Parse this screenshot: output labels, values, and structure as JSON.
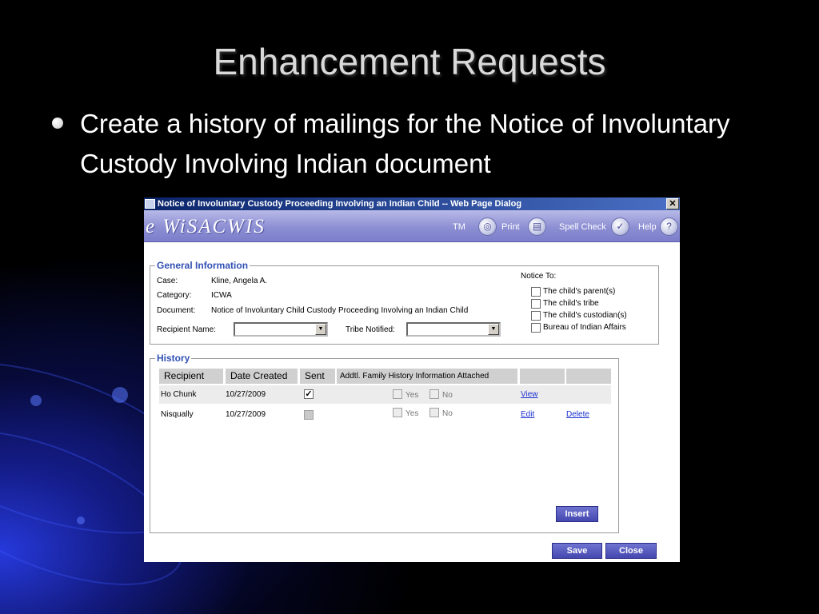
{
  "slide": {
    "title": "Enhancement Requests",
    "bullet": "Create a history of mailings for the Notice of Involuntary Custody Involving Indian document"
  },
  "dialog": {
    "title": "Notice of Involuntary Custody Proceeding Involving an Indian Child -- Web Page Dialog",
    "close_glyph": "✕",
    "logo": "e WiSACWIS",
    "header_links": {
      "tm": "TM",
      "print": "Print",
      "spell_check": "Spell Check",
      "help": "Help"
    },
    "header_icons": [
      "globe-icon",
      "printer-icon",
      "spell-check-icon",
      "help-icon"
    ],
    "general_info": {
      "legend": "General Information",
      "case_label": "Case:",
      "case_value": "Kline, Angela A.",
      "category_label": "Category:",
      "category_value": "ICWA",
      "document_label": "Document:",
      "document_value": "Notice of Involuntary Child Custody Proceeding Involving an Indian Child",
      "recipient_label": "Recipient Name:",
      "recipient_value": "",
      "tribe_label": "Tribe Notified:",
      "tribe_value": "",
      "notice_to_label": "Notice To:",
      "notice_options": [
        {
          "label": "The child's parent(s)",
          "checked": false
        },
        {
          "label": "The child's tribe",
          "checked": false
        },
        {
          "label": "The child's custodian(s)",
          "checked": false
        },
        {
          "label": "Bureau of Indian Affairs",
          "checked": false
        }
      ]
    },
    "history": {
      "legend": "History",
      "columns": [
        "Recipient",
        "Date Created",
        "Sent",
        "Addtl. Family History Information Attached",
        "",
        ""
      ],
      "yes_label": "Yes",
      "no_label": "No",
      "rows": [
        {
          "recipient": "Ho Chunk",
          "date_created": "10/27/2009",
          "sent": true,
          "sent_enabled": true,
          "yes": false,
          "no": false,
          "action1": "View",
          "action2": ""
        },
        {
          "recipient": "Nisqually",
          "date_created": "10/27/2009",
          "sent": false,
          "sent_enabled": false,
          "yes": false,
          "no": false,
          "action1": "Edit",
          "action2": "Delete"
        }
      ],
      "insert_button": "Insert"
    },
    "save_button": "Save",
    "close_button": "Close"
  },
  "colors": {
    "title_bar": "#0a246a",
    "header_band": "#8d8fd3",
    "legend_text": "#3150b4",
    "button": "#4448b0",
    "link": "#1a2fd0"
  }
}
